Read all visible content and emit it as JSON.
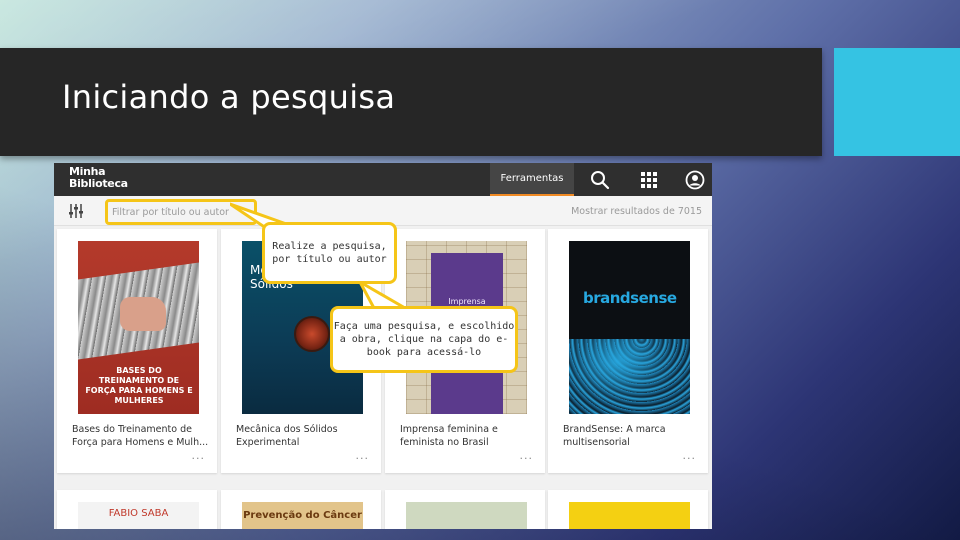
{
  "slide": {
    "title": "Iniciando a pesquisa",
    "accent_color": "#35c3e3"
  },
  "app": {
    "logo_line1": "Minha",
    "logo_line2": "Biblioteca",
    "tools_label": "Ferramentas",
    "icons": [
      "search-icon",
      "apps-grid-icon",
      "account-icon",
      "filter-sliders-icon"
    ],
    "filter_placeholder": "Filtrar por título ou autor",
    "results_text": "Mostrar resultados de 7015",
    "accent_color": "#f08a24"
  },
  "books": [
    {
      "title": "Bases do Treinamento de Força para Homens e Mulh...",
      "cover_text": "BASES DO TREINAMENTO DE FORÇA PARA HOMENS E MULHERES"
    },
    {
      "title": "Mecânica dos Sólidos Experimental",
      "cover_text": "Mecânica dos Sólidos"
    },
    {
      "title": "Imprensa feminina e feminista no Brasil",
      "cover_text": "Imprensa"
    },
    {
      "title": "BrandSense: A marca multisensorial",
      "cover_text": "brandsense"
    }
  ],
  "books_row2": [
    {
      "cover_text": "FABIO SABA"
    },
    {
      "cover_text": "Prevenção do Câncer"
    },
    {
      "cover_text": ""
    },
    {
      "cover_text": ""
    }
  ],
  "callouts": {
    "search": "Realize a pesquisa, por título ou autor",
    "open": "Faça uma pesquisa, e escolhido a obra, clique na capa do e-book para acessá-lo"
  },
  "more_label": "···"
}
